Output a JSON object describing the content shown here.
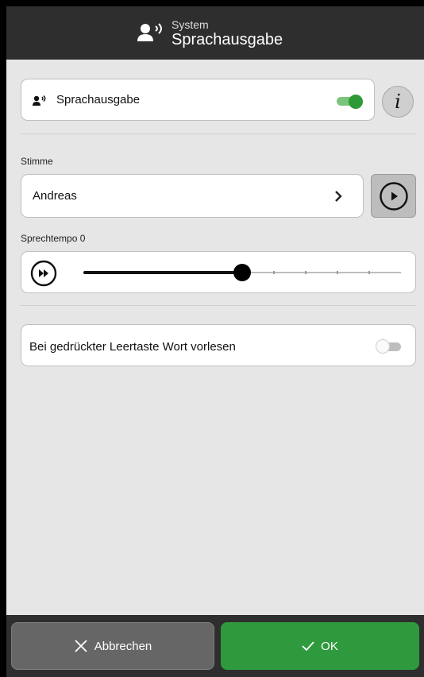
{
  "header": {
    "subtitle": "System",
    "title": "Sprachausgabe",
    "icon": "speaking-person-icon"
  },
  "speech_output": {
    "label": "Sprachausgabe",
    "enabled": true,
    "info_glyph": "i"
  },
  "voice": {
    "section_label": "Stimme",
    "selected": "Andreas"
  },
  "speed": {
    "label": "Sprechtempo 0",
    "value": 0,
    "range": [
      -5,
      5
    ]
  },
  "space_read": {
    "label": "Bei gedrückter Leertaste Wort vorlesen",
    "enabled": false
  },
  "footer": {
    "cancel_label": "Abbrechen",
    "ok_label": "OK"
  },
  "colors": {
    "accent_green": "#2e9a3d",
    "header_bg": "#2e2e2e",
    "panel_bg": "#e6e6e6"
  }
}
